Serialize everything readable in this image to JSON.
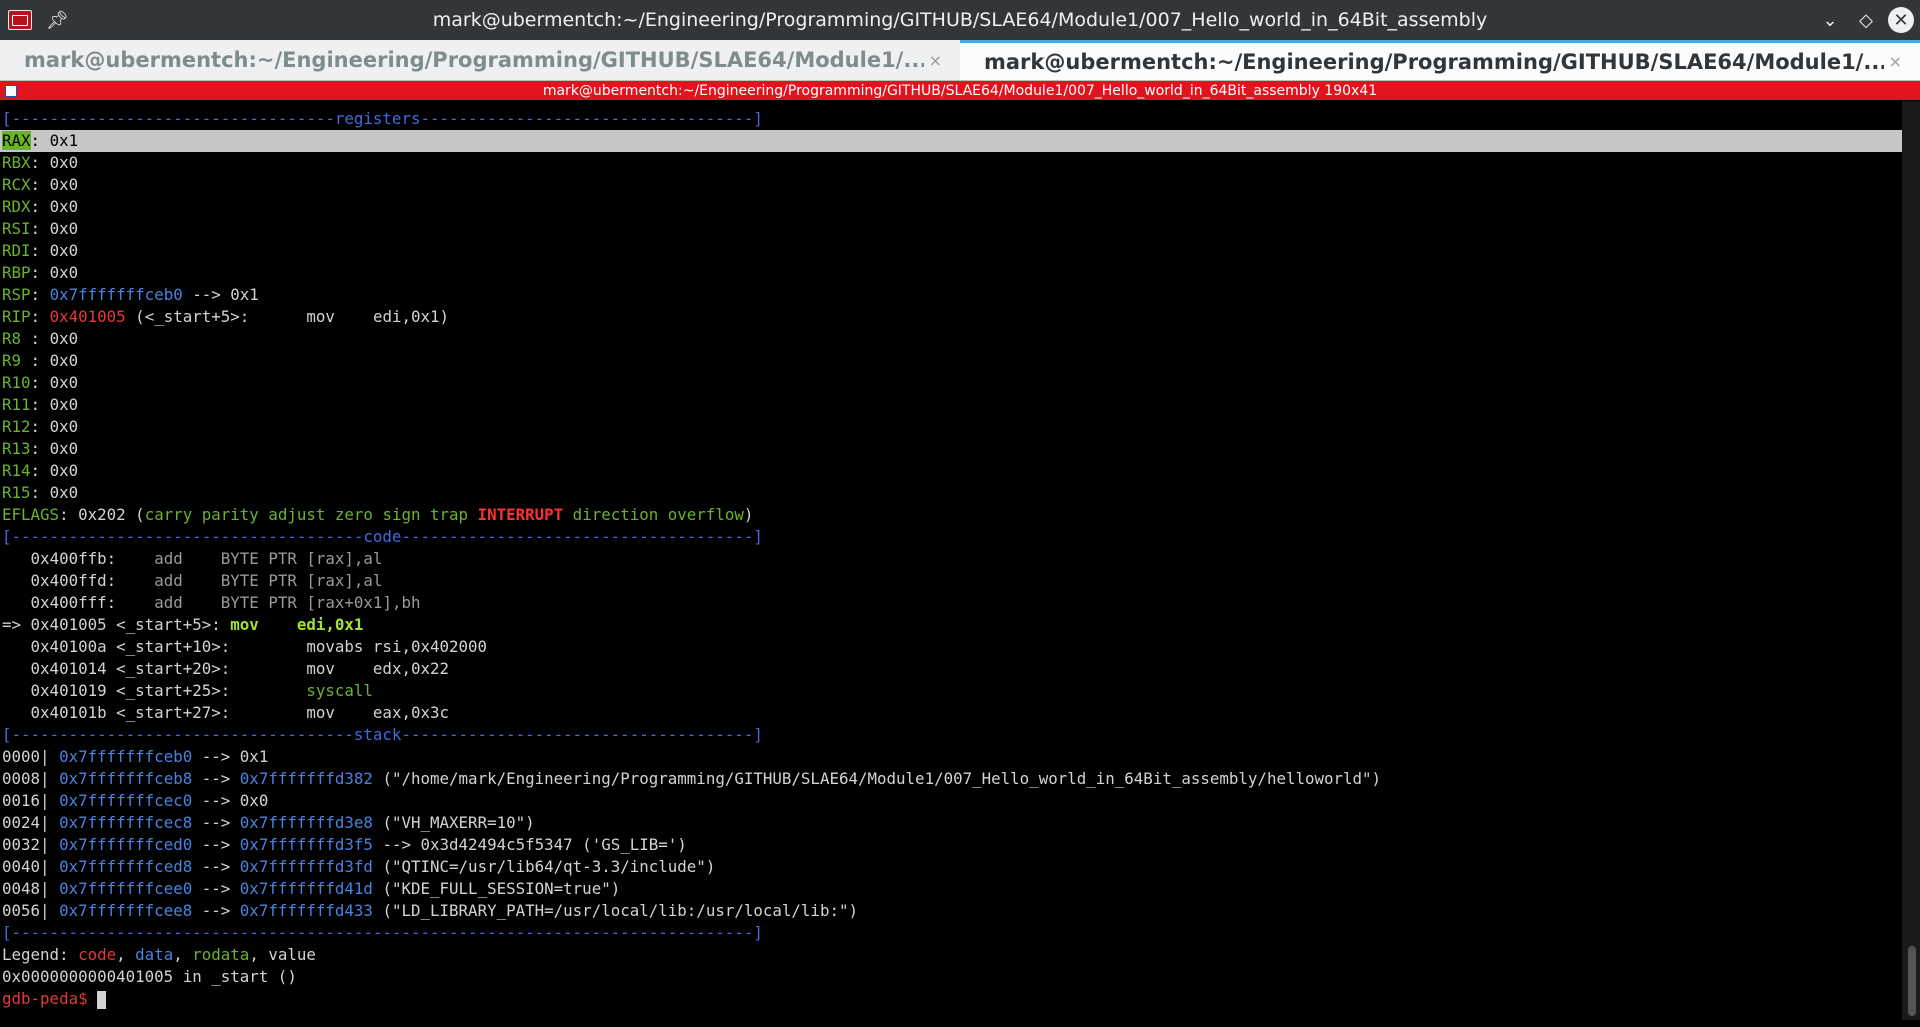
{
  "window": {
    "title": "mark@ubermentch:~/Engineering/Programming/GITHUB/SLAE64/Module1/007_Hello_world_in_64Bit_assembly",
    "pin_icon": "pin-icon",
    "controls": [
      "minimize-icon",
      "maximize-icon",
      "close-icon"
    ]
  },
  "tabs": [
    {
      "label": "mark@ubermentch:~/Engineering/Programming/GITHUB/SLAE64/Module1/...",
      "close": "×"
    },
    {
      "label": "mark@ubermentch:~/Engineering/Programming/GITHUB/SLAE64/Module1/...",
      "close": "×"
    }
  ],
  "session": {
    "title": "mark@ubermentch:~/Engineering/Programming/GITHUB/SLAE64/Module1/007_Hello_world_in_64Bit_assembly 190x41"
  },
  "terminal": {
    "sep_registers": "[----------------------------------registers-----------------------------------]",
    "sep_code": "[-------------------------------------code-------------------------------------]",
    "sep_stack": "[------------------------------------stack-------------------------------------]",
    "sep_end": "[------------------------------------------------------------------------------]",
    "registers": [
      {
        "name": "RAX",
        "sep": ": ",
        "value": "0x1"
      },
      {
        "name": "RBX",
        "sep": ": ",
        "value": "0x0"
      },
      {
        "name": "RCX",
        "sep": ": ",
        "value": "0x0"
      },
      {
        "name": "RDX",
        "sep": ": ",
        "value": "0x0"
      },
      {
        "name": "RSI",
        "sep": ": ",
        "value": "0x0"
      },
      {
        "name": "RDI",
        "sep": ": ",
        "value": "0x0"
      },
      {
        "name": "RBP",
        "sep": ": ",
        "value": "0x0"
      },
      {
        "name": "RSP",
        "sep": ": ",
        "addr": "0x7fffffffceb0",
        "value": " --> 0x1"
      },
      {
        "name": "RIP",
        "sep": ": ",
        "addr": "0x401005",
        "value": " (<_start+5>:      mov    edi,0x1)"
      },
      {
        "name": "R8",
        "sep": " : ",
        "value": "0x0"
      },
      {
        "name": "R9",
        "sep": " : ",
        "value": "0x0"
      },
      {
        "name": "R10",
        "sep": ": ",
        "value": "0x0"
      },
      {
        "name": "R11",
        "sep": ": ",
        "value": "0x0"
      },
      {
        "name": "R12",
        "sep": ": ",
        "value": "0x0"
      },
      {
        "name": "R13",
        "sep": ": ",
        "value": "0x0"
      },
      {
        "name": "R14",
        "sep": ": ",
        "value": "0x0"
      },
      {
        "name": "R15",
        "sep": ": ",
        "value": "0x0"
      }
    ],
    "eflags": {
      "name": "EFLAGS",
      "value": ": 0x202 (",
      "flags_a": "carry parity adjust zero sign trap ",
      "flag_set": "INTERRUPT",
      "flags_b": " direction overflow",
      "close": ")"
    },
    "code": [
      {
        "prefix": "   ",
        "addr": "0x400ffb:    ",
        "instr": "add    BYTE PTR [rax],al"
      },
      {
        "prefix": "   ",
        "addr": "0x400ffd:    ",
        "instr": "add    BYTE PTR [rax],al"
      },
      {
        "prefix": "   ",
        "addr": "0x400fff:    ",
        "instr": "add    BYTE PTR [rax+0x1],bh"
      }
    ],
    "code_current": {
      "prefix": "=> 0x401005 <_start+5>: ",
      "instr": "mov    edi,0x1"
    },
    "code_next": [
      {
        "text": "   0x40100a <_start+10>:        ",
        "instr": "movabs rsi,0x402000",
        "kind": "normal"
      },
      {
        "text": "   0x401014 <_start+20>:        ",
        "instr": "mov    edx,0x22",
        "kind": "normal"
      },
      {
        "text": "   0x401019 <_start+25>:        ",
        "instr": "syscall",
        "kind": "green"
      },
      {
        "text": "   0x40101b <_start+27>:        ",
        "instr": "mov    eax,0x3c",
        "kind": "normal"
      }
    ],
    "stack": [
      {
        "off": "0000| ",
        "addr": "0x7fffffffceb0",
        "arrow": " --> ",
        "target": "",
        "rest": "0x1"
      },
      {
        "off": "0008| ",
        "addr": "0x7fffffffceb8",
        "arrow": " --> ",
        "target": "0x7fffffffd382",
        "rest": " (\"/home/mark/Engineering/Programming/GITHUB/SLAE64/Module1/007_Hello_world_in_64Bit_assembly/helloworld\")"
      },
      {
        "off": "0016| ",
        "addr": "0x7fffffffcec0",
        "arrow": " --> ",
        "target": "",
        "rest": "0x0"
      },
      {
        "off": "0024| ",
        "addr": "0x7fffffffcec8",
        "arrow": " --> ",
        "target": "0x7fffffffd3e8",
        "rest": " (\"VH_MAXERR=10\")"
      },
      {
        "off": "0032| ",
        "addr": "0x7fffffffced0",
        "arrow": " --> ",
        "target": "0x7fffffffd3f5",
        "rest": " --> 0x3d42494c5f5347 ('GS_LIB=')"
      },
      {
        "off": "0040| ",
        "addr": "0x7fffffffced8",
        "arrow": " --> ",
        "target": "0x7fffffffd3fd",
        "rest": " (\"QTINC=/usr/lib64/qt-3.3/include\")"
      },
      {
        "off": "0048| ",
        "addr": "0x7fffffffcee0",
        "arrow": " --> ",
        "target": "0x7fffffffd41d",
        "rest": " (\"KDE_FULL_SESSION=true\")"
      },
      {
        "off": "0056| ",
        "addr": "0x7fffffffcee8",
        "arrow": " --> ",
        "target": "0x7fffffffd433",
        "rest": " (\"LD_LIBRARY_PATH=/usr/local/lib:/usr/local/lib:\")"
      }
    ],
    "legend": {
      "label": "Legend: ",
      "code": "code",
      "c1": ", ",
      "data": "data",
      "c2": ", ",
      "rodata": "rodata",
      "c3": ", ",
      "value": "value"
    },
    "location": "0x0000000000401005 in _start ()",
    "prompt": "gdb-peda$ "
  }
}
